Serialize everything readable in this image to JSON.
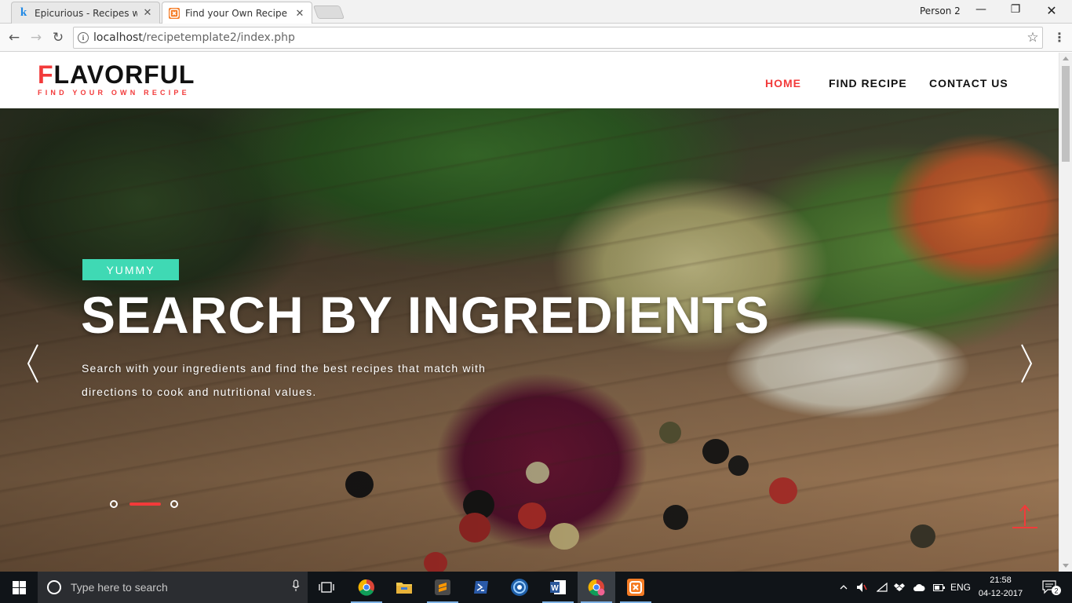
{
  "browser": {
    "tabs": [
      {
        "label": "Epicurious - Recipes with",
        "favicon": "k",
        "active": false
      },
      {
        "label": "Find your Own Recipe",
        "favicon": "xampp",
        "active": true
      }
    ],
    "profile": "Person 2",
    "url_host": "localhost",
    "url_path": "/recipetemplate2/index.php"
  },
  "site": {
    "logo_first": "F",
    "logo_rest": "LAVORFUL",
    "tagline": "FIND YOUR OWN RECIPE",
    "nav": [
      {
        "label": "HOME",
        "active": true
      },
      {
        "label": "FIND RECIPE",
        "active": false
      },
      {
        "label": "CONTACT US",
        "active": false
      }
    ]
  },
  "hero": {
    "badge": "YUMMY",
    "headline": "SEARCH BY INGREDIENTS",
    "subtext": "Search with your ingredients and find the best recipes that match with directions to cook and nutritional values.",
    "slide_count": 3,
    "active_slide": 2
  },
  "taskbar": {
    "search_placeholder": "Type here to search",
    "language": "ENG",
    "time": "21:58",
    "date": "04-12-2017",
    "notifications": "2"
  },
  "colors": {
    "accent_red": "#f23a3a",
    "badge_teal": "#3fd9b4",
    "taskbar": "#101418"
  }
}
